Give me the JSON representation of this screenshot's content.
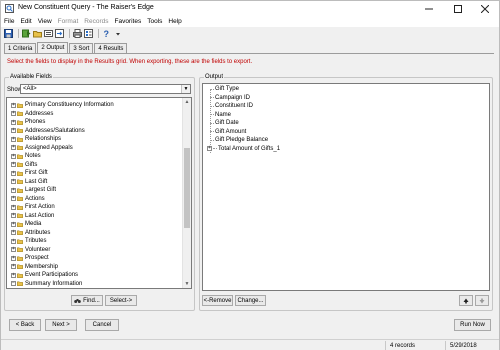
{
  "window": {
    "title": "New Constituent Query - The Raiser's Edge"
  },
  "menu": [
    "File",
    "Edit",
    "View",
    "Format",
    "Records",
    "Favorites",
    "Tools",
    "Help"
  ],
  "menu_disabled": [
    "Format",
    "Records"
  ],
  "tabs": [
    "1 Criteria",
    "2 Output",
    "3 Sort",
    "4 Results"
  ],
  "active_tab": "2 Output",
  "instruction": "Select the fields to display in the Results grid.  When exporting, these are the fields to export.",
  "available_fields": {
    "label": "Available Fields",
    "show_label": "Show:",
    "show_value": "<All>",
    "items": [
      "Primary Constituency Information",
      "Addresses",
      "Phones",
      "Addresses/Salutations",
      "Relationships",
      "Assigned Appeals",
      "Notes",
      "Gifts",
      "First Gift",
      "Last Gift",
      "Largest Gift",
      "Actions",
      "First Action",
      "Last Action",
      "Media",
      "Attributes",
      "Tributes",
      "Volunteer",
      "Prospect",
      "Membership",
      "Event Participations",
      "Summary Information"
    ],
    "expanded_last": "Summary Information",
    "find_label": "Find...",
    "select_label": "Select->"
  },
  "output": {
    "label": "Output",
    "items": [
      "Gift Type",
      "Campaign ID",
      "Constituent ID",
      "Name",
      "Gift Date",
      "Gift Amount",
      "Gift Pledge Balance",
      "Total Amount of Gifts_1"
    ],
    "expandable_item": "Total Amount of Gifts_1",
    "remove_label": "<-Remove",
    "change_label": "Change..."
  },
  "buttons": {
    "back": "< Back",
    "next": "Next >",
    "cancel": "Cancel",
    "run_now": "Run Now"
  },
  "status": {
    "records": "4 records",
    "date": "5/29/2018"
  }
}
